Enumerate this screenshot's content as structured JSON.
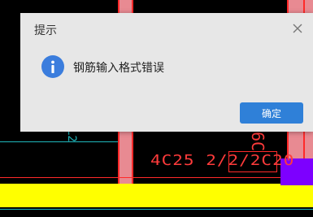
{
  "dialog": {
    "title": "提示",
    "message": "钢筋输入格式错误",
    "ok_label": "确定",
    "icon": "info-icon",
    "close_icon": "close-icon",
    "accent_color": "#2f80d8"
  },
  "cad": {
    "beam_annotation": "4C25 2/2/2C20",
    "vertical_annotation": "6C",
    "cyan_annotation": "L2"
  }
}
